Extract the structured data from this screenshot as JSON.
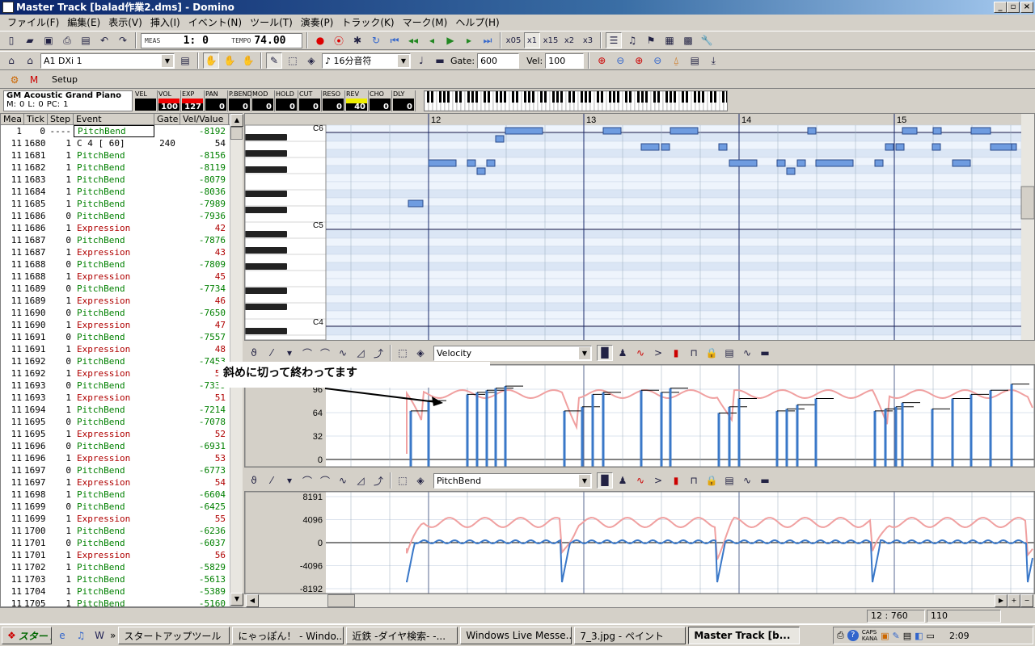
{
  "window": {
    "title": "Master Track [balad作業2.dms] - Domino"
  },
  "menu": [
    "ファイル(F)",
    "編集(E)",
    "表示(V)",
    "挿入(I)",
    "イベント(N)",
    "ツール(T)",
    "演奏(P)",
    "トラック(K)",
    "マーク(M)",
    "ヘルプ(H)"
  ],
  "toolbar1": {
    "meas_label": "MEAS",
    "position": "1:   0",
    "tempo_label": "TEMPO",
    "tempo": "74.00",
    "zoom_options": [
      "x05",
      "x1",
      "x15",
      "x2",
      "x3"
    ]
  },
  "toolbar2": {
    "track": "A1  DXi 1",
    "note_length": "♪ 16分音符",
    "gate_label": "Gate:",
    "gate": "600",
    "vel_label": "Vel:",
    "vel": "100"
  },
  "toolbar3": {
    "setup_label": "Setup"
  },
  "mixer": {
    "instrument": "GM Acoustic Grand Piano",
    "m_label": "M:",
    "m": "0",
    "l_label": "L:",
    "l": "0",
    "pc_label": "PC:",
    "pc": "1",
    "channels": [
      {
        "name": "VEL",
        "value": ""
      },
      {
        "name": "VOL",
        "value": "100"
      },
      {
        "name": "EXP",
        "value": "127"
      },
      {
        "name": "PAN",
        "value": "0"
      },
      {
        "name": "P.BEND",
        "value": "0"
      },
      {
        "name": "MOD",
        "value": "0"
      },
      {
        "name": "HOLD",
        "value": "0"
      },
      {
        "name": "CUT",
        "value": "0"
      },
      {
        "name": "RESO",
        "value": "0"
      },
      {
        "name": "REV",
        "value": "40"
      },
      {
        "name": "CHO",
        "value": "0"
      },
      {
        "name": "DLY",
        "value": "0"
      }
    ]
  },
  "event_list": {
    "columns": [
      "Mea",
      "Tick",
      "Step",
      "Event",
      "Gate",
      "Vel/Value"
    ],
    "rows": [
      [
        "1",
        "0",
        "----",
        "PitchBend",
        "",
        "-8192"
      ],
      [
        "11",
        "1680",
        "1",
        "C  4 [ 60]",
        "240",
        "54"
      ],
      [
        "11",
        "1681",
        "1",
        "PitchBend",
        "",
        "-8156"
      ],
      [
        "11",
        "1682",
        "1",
        "PitchBend",
        "",
        "-8119"
      ],
      [
        "11",
        "1683",
        "1",
        "PitchBend",
        "",
        "-8079"
      ],
      [
        "11",
        "1684",
        "1",
        "PitchBend",
        "",
        "-8036"
      ],
      [
        "11",
        "1685",
        "1",
        "PitchBend",
        "",
        "-7989"
      ],
      [
        "11",
        "1686",
        "0",
        "PitchBend",
        "",
        "-7936"
      ],
      [
        "11",
        "1686",
        "1",
        "Expression",
        "",
        "42"
      ],
      [
        "11",
        "1687",
        "0",
        "PitchBend",
        "",
        "-7876"
      ],
      [
        "11",
        "1687",
        "1",
        "Expression",
        "",
        "43"
      ],
      [
        "11",
        "1688",
        "0",
        "PitchBend",
        "",
        "-7809"
      ],
      [
        "11",
        "1688",
        "1",
        "Expression",
        "",
        "45"
      ],
      [
        "11",
        "1689",
        "0",
        "PitchBend",
        "",
        "-7734"
      ],
      [
        "11",
        "1689",
        "1",
        "Expression",
        "",
        "46"
      ],
      [
        "11",
        "1690",
        "0",
        "PitchBend",
        "",
        "-7650"
      ],
      [
        "11",
        "1690",
        "1",
        "Expression",
        "",
        "47"
      ],
      [
        "11",
        "1691",
        "0",
        "PitchBend",
        "",
        "-7557"
      ],
      [
        "11",
        "1691",
        "1",
        "Expression",
        "",
        "48"
      ],
      [
        "11",
        "1692",
        "0",
        "PitchBend",
        "",
        "-7453"
      ],
      [
        "11",
        "1692",
        "1",
        "Expression",
        "",
        "50"
      ],
      [
        "11",
        "1693",
        "0",
        "PitchBend",
        "",
        "-7339"
      ],
      [
        "11",
        "1693",
        "1",
        "Expression",
        "",
        "51"
      ],
      [
        "11",
        "1694",
        "1",
        "PitchBend",
        "",
        "-7214"
      ],
      [
        "11",
        "1695",
        "0",
        "PitchBend",
        "",
        "-7078"
      ],
      [
        "11",
        "1695",
        "1",
        "Expression",
        "",
        "52"
      ],
      [
        "11",
        "1696",
        "0",
        "PitchBend",
        "",
        "-6931"
      ],
      [
        "11",
        "1696",
        "1",
        "Expression",
        "",
        "53"
      ],
      [
        "11",
        "1697",
        "0",
        "PitchBend",
        "",
        "-6773"
      ],
      [
        "11",
        "1697",
        "1",
        "Expression",
        "",
        "54"
      ],
      [
        "11",
        "1698",
        "1",
        "PitchBend",
        "",
        "-6604"
      ],
      [
        "11",
        "1699",
        "0",
        "PitchBend",
        "",
        "-6425"
      ],
      [
        "11",
        "1699",
        "1",
        "Expression",
        "",
        "55"
      ],
      [
        "11",
        "1700",
        "1",
        "PitchBend",
        "",
        "-6236"
      ],
      [
        "11",
        "1701",
        "0",
        "PitchBend",
        "",
        "-6037"
      ],
      [
        "11",
        "1701",
        "1",
        "Expression",
        "",
        "56"
      ],
      [
        "11",
        "1702",
        "1",
        "PitchBend",
        "",
        "-5829"
      ],
      [
        "11",
        "1703",
        "1",
        "PitchBend",
        "",
        "-5613"
      ],
      [
        "11",
        "1704",
        "1",
        "PitchBend",
        "",
        "-5389"
      ],
      [
        "11",
        "1705",
        "1",
        "PitchBend",
        "",
        "-5160"
      ]
    ]
  },
  "pianoroll": {
    "measures": [
      "12",
      "13",
      "14",
      "15"
    ],
    "octave_labels": [
      "C6",
      "C5",
      "C4"
    ]
  },
  "controller1": {
    "type": "Velocity",
    "ticks": [
      "96",
      "64",
      "32",
      "0"
    ],
    "annotation": "斜めに切って終わってます"
  },
  "controller2": {
    "type": "PitchBend",
    "ticks": [
      "8191",
      "4096",
      "0",
      "-4096",
      "-8192"
    ]
  },
  "status": {
    "position": "12 : 760",
    "value": "110"
  },
  "taskbar": {
    "start": "スタート",
    "tasks": [
      "スタートアップツール",
      "にゃっぽん！ - Windo...",
      "近鉄 -ダイヤ検索- -...",
      "Windows Live Messe...",
      "7_3.jpg - ペイント",
      "Master Track [b..."
    ],
    "caps": "CAPS",
    "kana": "KANA",
    "clock": "2:09"
  }
}
